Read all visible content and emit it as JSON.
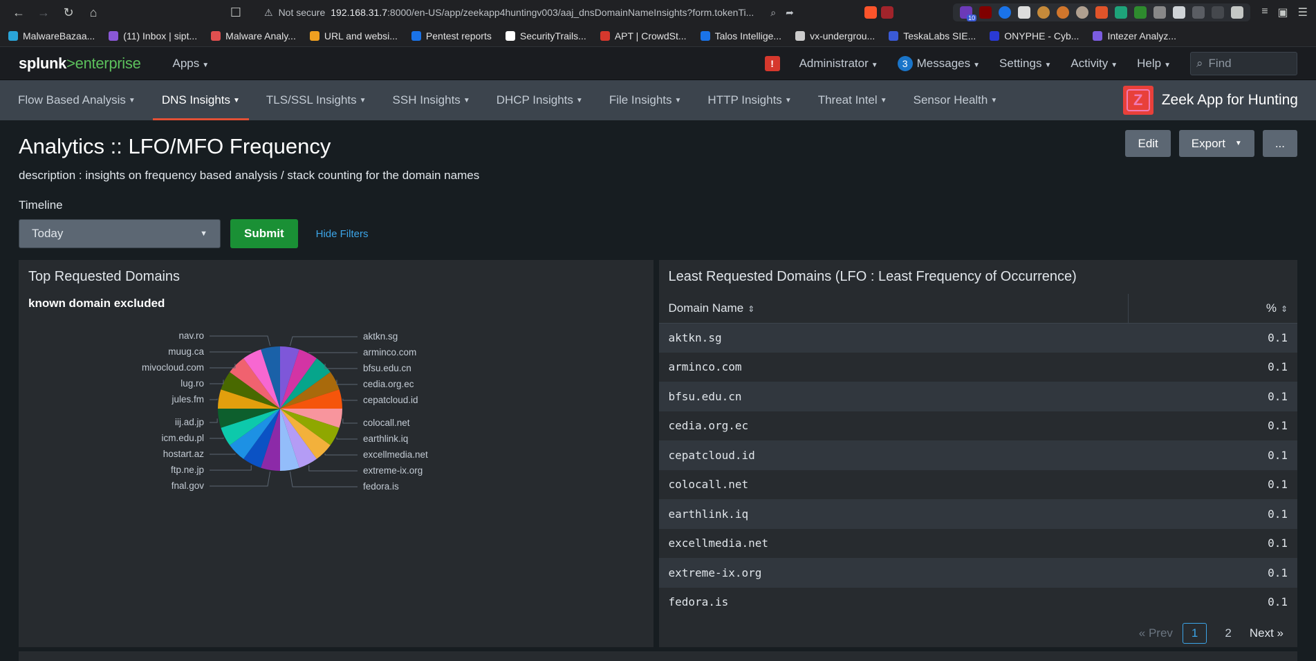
{
  "browser": {
    "security": "Not secure",
    "host": "192.168.31.7",
    "url_path": ":8000/en-US/app/zeekapp4huntingv003/aaj_dnsDomainNameInsights?form.tokenTi...",
    "ext_badge": "10"
  },
  "bookmarks": [
    {
      "label": "MalwareBazaa...",
      "color": "#2aa4d8"
    },
    {
      "label": "(11) Inbox | sipt...",
      "color": "#8a57d6"
    },
    {
      "label": "Malware Analy...",
      "color": "#e04f4f"
    },
    {
      "label": "URL and websi...",
      "color": "#f0a020"
    },
    {
      "label": "Pentest reports",
      "color": "#1a73e8"
    },
    {
      "label": "SecurityTrails...",
      "color": "#ffffff"
    },
    {
      "label": "APT | CrowdSt...",
      "color": "#d6382d"
    },
    {
      "label": "Talos Intellige...",
      "color": "#1a73e8"
    },
    {
      "label": "vx-undergrou...",
      "color": "#cccccc"
    },
    {
      "label": "TeskaLabs SIE...",
      "color": "#3a5ad6"
    },
    {
      "label": "ONYPHE - Cyb...",
      "color": "#2a3ad6"
    },
    {
      "label": "Intezer Analyz...",
      "color": "#7b5ce0"
    }
  ],
  "splunk": {
    "logo_main": "splunk",
    "logo_gt": ">",
    "logo_sub": "enterprise",
    "apps": "Apps",
    "alert_icon": "!",
    "administrator": "Administrator",
    "messages_count": "3",
    "messages": "Messages",
    "settings": "Settings",
    "activity": "Activity",
    "help": "Help",
    "find_placeholder": "Find"
  },
  "app_nav": {
    "items": [
      "Flow Based Analysis",
      "DNS Insights",
      "TLS/SSL Insights",
      "SSH Insights",
      "DHCP Insights",
      "File Insights",
      "HTTP Insights",
      "Threat Intel",
      "Sensor Health"
    ],
    "active_index": 1,
    "app_logo_letter": "Z",
    "app_name": "Zeek App for Hunting"
  },
  "dashboard": {
    "title": "Analytics :: LFO/MFO Frequency",
    "description": "description : insights on frequency based analysis / stack counting for the domain names",
    "edit": "Edit",
    "export": "Export",
    "more": "...",
    "timeline_label": "Timeline",
    "timeline_value": "Today",
    "submit": "Submit",
    "hide_filters": "Hide Filters"
  },
  "left_panel": {
    "title": "Top Requested Domains",
    "subtitle": "known domain excluded"
  },
  "chart_data": {
    "type": "pie",
    "title": "",
    "categories": [
      "aktkn.sg",
      "arminco.com",
      "bfsu.edu.cn",
      "cedia.org.ec",
      "cepatcloud.id",
      "colocall.net",
      "earthlink.iq",
      "excellmedia.net",
      "extreme-ix.org",
      "fedora.is",
      "fnal.gov",
      "ftp.ne.jp",
      "hostart.az",
      "icm.edu.pl",
      "iij.ad.jp",
      "jules.fm",
      "lug.ro",
      "mivocloud.com",
      "muug.ca",
      "nav.ro"
    ],
    "values": [
      1,
      1,
      1,
      1,
      1,
      1,
      1,
      1,
      1,
      1,
      1,
      1,
      1,
      1,
      1,
      1,
      1,
      1,
      1,
      1
    ],
    "colors": [
      "#7e57d9",
      "#d334a4",
      "#06a58b",
      "#a96a0b",
      "#f5550b",
      "#f8959d",
      "#8fa700",
      "#f3b13b",
      "#b49cf5",
      "#93bdfa",
      "#8c2aa8",
      "#0b52c4",
      "#1d91e4",
      "#0dc9ab",
      "#0d5f2d",
      "#e29f0d",
      "#496900",
      "#f0626f",
      "#f767d1",
      "#1a61a8"
    ]
  },
  "right_panel": {
    "title": "Least Requested Domains (LFO : Least Frequency of Occurrence)",
    "col_domain": "Domain Name",
    "col_pct": "%",
    "rows": [
      {
        "domain": "aktkn.sg",
        "pct": "0.1"
      },
      {
        "domain": "arminco.com",
        "pct": "0.1"
      },
      {
        "domain": "bfsu.edu.cn",
        "pct": "0.1"
      },
      {
        "domain": "cedia.org.ec",
        "pct": "0.1"
      },
      {
        "domain": "cepatcloud.id",
        "pct": "0.1"
      },
      {
        "domain": "colocall.net",
        "pct": "0.1"
      },
      {
        "domain": "earthlink.iq",
        "pct": "0.1"
      },
      {
        "domain": "excellmedia.net",
        "pct": "0.1"
      },
      {
        "domain": "extreme-ix.org",
        "pct": "0.1"
      },
      {
        "domain": "fedora.is",
        "pct": "0.1"
      }
    ],
    "pager": {
      "prev": "« Prev",
      "pages": [
        "1",
        "2"
      ],
      "current": "1",
      "next": "Next »"
    }
  }
}
